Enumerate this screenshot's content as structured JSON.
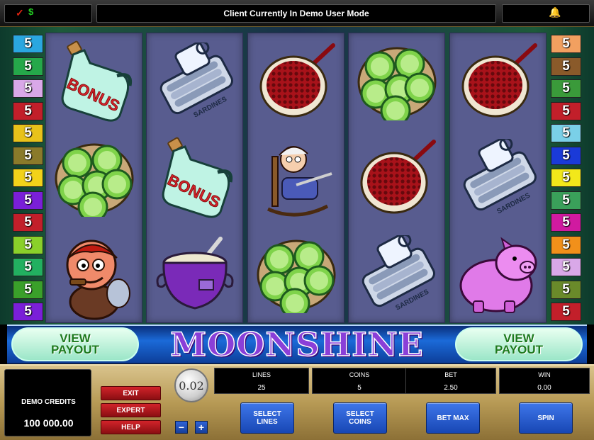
{
  "topbar": {
    "status_text": "Client Currently In Demo User Mode",
    "check_icon": "check-icon",
    "dollar_icon": "dollar-icon",
    "bell_icon": "bell-icon",
    "check_glyph": "✓",
    "dollar_glyph": "$",
    "bell_glyph": "🔔"
  },
  "paylines": {
    "left": [
      "5",
      "5",
      "5",
      "5",
      "5",
      "5",
      "5",
      "5",
      "5",
      "5",
      "5",
      "5",
      "5"
    ],
    "right": [
      "5",
      "5",
      "5",
      "5",
      "5",
      "5",
      "5",
      "5",
      "5",
      "5",
      "5",
      "5",
      "5"
    ],
    "left_colors": [
      "#2aa7e0",
      "#25a84a",
      "#d9a8e8",
      "#c21f2a",
      "#e8c21a",
      "#8a7a2a",
      "#f2d21a",
      "#7a1fd8",
      "#c21f2a",
      "#8ad02a",
      "#22b060",
      "#3aa02a",
      "#7a1fd8"
    ],
    "right_colors": [
      "#f2a060",
      "#8a5a2a",
      "#3a9a3a",
      "#c21f2a",
      "#7ad0e8",
      "#1a3ad8",
      "#f2e81a",
      "#3aa05a",
      "#d01aa0",
      "#f2901a",
      "#d9a8e8",
      "#6a8a2a",
      "#c21f2a"
    ]
  },
  "reels": [
    [
      "bonus-jug",
      "sliced-cucumbers",
      "hillbilly"
    ],
    [
      "sardines-can",
      "bonus-jug",
      "cooking-pot"
    ],
    [
      "red-beans-pan",
      "granny-rocking-chair",
      "sliced-cucumbers"
    ],
    [
      "sliced-cucumbers",
      "red-beans-pan",
      "sardines-can"
    ],
    [
      "red-beans-pan",
      "sardines-can",
      "pink-hog"
    ]
  ],
  "bonus_label": "BONUS",
  "sardines_label": "SARDINES",
  "banner": {
    "title": "MOONSHINE",
    "payout_left": "VIEW\nPAYOUT",
    "payout_right": "VIEW\nPAYOUT"
  },
  "panel": {
    "credits_label": "DEMO CREDITS",
    "credits_value": "100 000.00",
    "exit_label": "EXIT",
    "expert_label": "EXPERT",
    "help_label": "HELP",
    "coin_value": "0.02",
    "minus_label": "−",
    "plus_label": "+",
    "lines_label": "LINES",
    "lines_value": "25",
    "coins_label": "COINS",
    "coins_value": "5",
    "bet_label": "BET",
    "bet_value": "2.50",
    "win_label": "WIN",
    "win_value": "0.00",
    "select_lines_label": "SELECT\nLINES",
    "select_coins_label": "SELECT\nCOINS",
    "bet_max_label": "BET MAX",
    "spin_label": "SPIN"
  }
}
